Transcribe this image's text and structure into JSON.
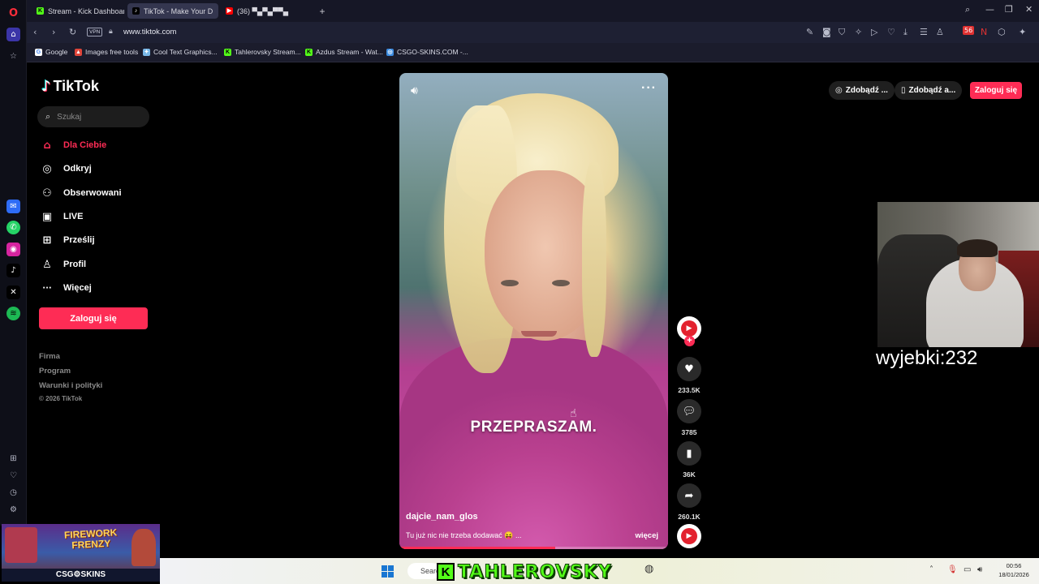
{
  "browser": {
    "tabs": [
      {
        "title": "Stream - Kick Dashboard",
        "fav": "K",
        "fav_color": "#53fc18"
      },
      {
        "title": "TikTok - Make Your D",
        "fav": "♪",
        "fav_color": "#000000"
      },
      {
        "title": "(36) ▀▄▀▄▀▀▄",
        "fav": "▶",
        "fav_color": "#ff0000"
      }
    ],
    "url": "www.tiktok.com",
    "vpn_label": "VPN",
    "bookmarks": [
      {
        "label": "Google",
        "fav": "G",
        "color": "#ffffff"
      },
      {
        "label": "Images free tools",
        "fav": "▲",
        "color": "#e0453a"
      },
      {
        "label": "Cool Text Graphics...",
        "fav": "✦",
        "color": "#7ab8e8"
      },
      {
        "label": "Tahlerovsky Stream...",
        "fav": "K",
        "color": "#53fc18"
      },
      {
        "label": "Azdus Stream - Wat...",
        "fav": "K",
        "color": "#53fc18"
      },
      {
        "label": "CSGO-SKINS.COM -...",
        "fav": "◎",
        "color": "#3b8be0"
      }
    ],
    "badge_count": "56"
  },
  "tiktok": {
    "logo": "TikTok",
    "search_placeholder": "Szukaj",
    "nav": [
      {
        "label": "Dla Ciebie",
        "icon": "home-icon",
        "glyph": "⌂"
      },
      {
        "label": "Odkryj",
        "icon": "compass-icon",
        "glyph": "◎"
      },
      {
        "label": "Obserwowani",
        "icon": "following-icon",
        "glyph": "⚇"
      },
      {
        "label": "LIVE",
        "icon": "live-icon",
        "glyph": "▣"
      },
      {
        "label": "Prześlij",
        "icon": "upload-icon",
        "glyph": "⊞"
      },
      {
        "label": "Profil",
        "icon": "profile-icon",
        "glyph": "♙"
      },
      {
        "label": "Więcej",
        "icon": "more-icon",
        "glyph": "···"
      }
    ],
    "login_label": "Zaloguj się",
    "footer": [
      "Firma",
      "Program",
      "Warunki i polityki",
      "© 2026 TikTok"
    ],
    "top_pills": [
      {
        "label": "Zdobądź ...",
        "icon": "tiktok-icon"
      },
      {
        "label": "Zdobądź a...",
        "icon": "phone-icon"
      }
    ],
    "video": {
      "caption": "PRZEPRASZAM.",
      "author": "dajcie_nam_glos",
      "description": "Tu już nic nie trzeba dodawać 😝 ...",
      "more_label": "więcej",
      "progress": 0.58
    },
    "actions": {
      "likes": "233.5K",
      "comments": "3785",
      "saves": "36K",
      "shares": "260.1K"
    }
  },
  "overlay": {
    "cam_label": "wyjebki:232",
    "promo_title": "FIREWORK FRENZY",
    "promo_brand": "CSG⚙SKINS",
    "kick_name": "TAHLEROVSKY"
  },
  "taskbar": {
    "search_label": "Search",
    "time": "00:56",
    "date": "18/01/2026"
  },
  "colors": {
    "accent": "#fe2c55",
    "kick": "#53fc18"
  }
}
